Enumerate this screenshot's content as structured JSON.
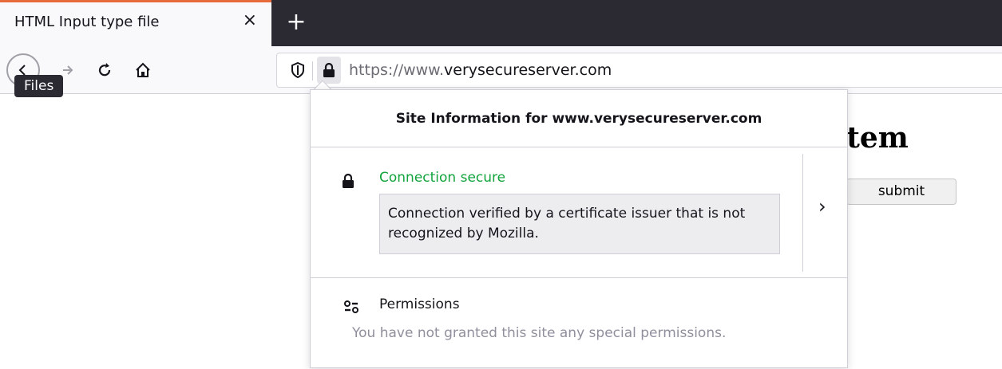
{
  "tab": {
    "title": "HTML Input type file",
    "close": "×"
  },
  "newtab": {
    "label": "+"
  },
  "urlbar": {
    "prefix": "https://www.",
    "domain": "verysecureserver.com"
  },
  "tooltip": {
    "text": "Files"
  },
  "page": {
    "heading": "stem",
    "submit": "submit"
  },
  "panel": {
    "header": "Site Information for www.verysecureserver.com",
    "connection": {
      "status": "Connection secure",
      "detail": "Connection verified by a certificate issuer that is not recognized by Mozilla.",
      "chevron": "›"
    },
    "permissions": {
      "title": "Permissions",
      "text": "You have not granted this site any special permissions."
    }
  },
  "colors": {
    "accent_tab": "#e66a3a",
    "secure": "#12a33d",
    "tabstrip": "#2b2a33"
  },
  "icons": [
    "back-arrow-icon",
    "forward-arrow-icon",
    "reload-icon",
    "home-icon",
    "shield-icon",
    "lock-icon",
    "chevron-right-icon",
    "permissions-icon"
  ]
}
